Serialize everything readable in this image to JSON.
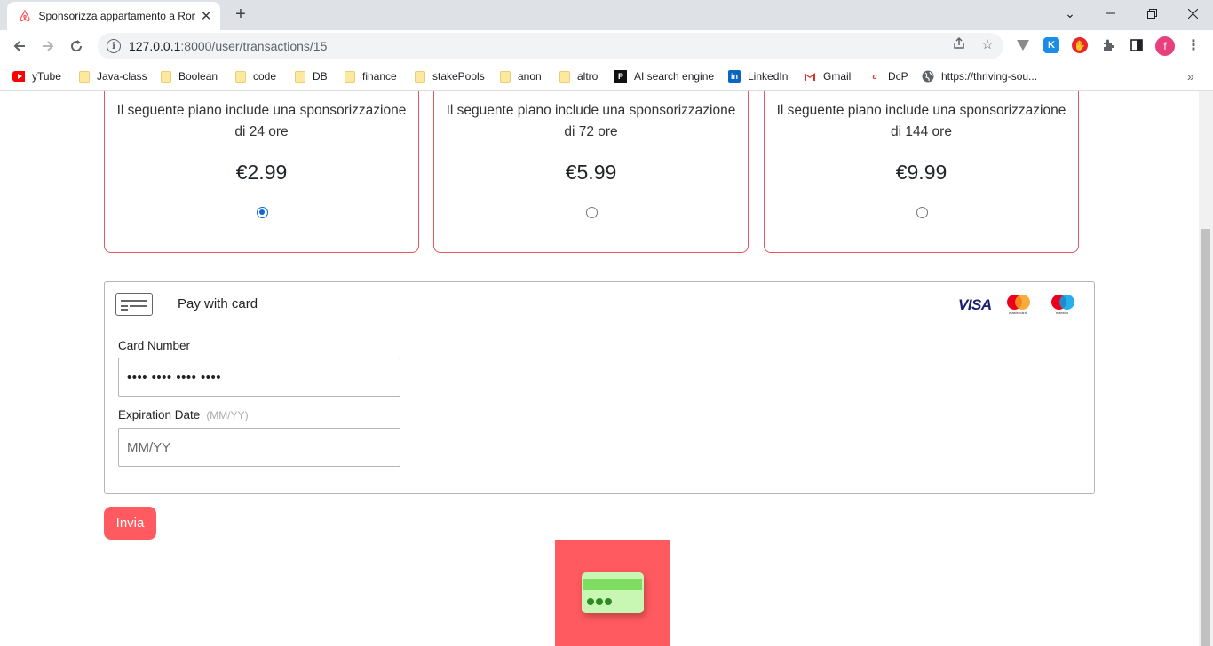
{
  "browser": {
    "tab_title": "Sponsorizza appartamento a Roma",
    "url_host": "127.0.0.1",
    "url_rest": ":8000/user/transactions/15",
    "profile_initial": "f",
    "bookmarks": [
      {
        "label": "yTube",
        "icon": "youtube-icon"
      },
      {
        "label": "Java-class",
        "icon": "folder-icon"
      },
      {
        "label": "Boolean",
        "icon": "folder-icon"
      },
      {
        "label": "code",
        "icon": "folder-icon"
      },
      {
        "label": "DB",
        "icon": "folder-icon"
      },
      {
        "label": "finance",
        "icon": "folder-icon"
      },
      {
        "label": "stakePools",
        "icon": "folder-icon"
      },
      {
        "label": "anon",
        "icon": "folder-icon"
      },
      {
        "label": "altro",
        "icon": "folder-icon"
      },
      {
        "label": "AI search engine",
        "icon": "perplexity-icon"
      },
      {
        "label": "LinkedIn",
        "icon": "linkedin-icon"
      },
      {
        "label": "Gmail",
        "icon": "gmail-icon"
      },
      {
        "label": "DcP",
        "icon": "dcp-icon"
      },
      {
        "label": "https://thriving-sou...",
        "icon": "globe-icon"
      }
    ]
  },
  "plans": [
    {
      "description": "Il seguente piano include una sponsorizzazione di 24 ore",
      "price": "€2.99",
      "selected": true
    },
    {
      "description": "Il seguente piano include una sponsorizzazione di 72 ore",
      "price": "€5.99",
      "selected": false
    },
    {
      "description": "Il seguente piano include una sponsorizzazione di 144 ore",
      "price": "€9.99",
      "selected": false
    }
  ],
  "payment": {
    "title": "Pay with card",
    "brand_visa": "VISA",
    "brand_mastercard": "mastercard",
    "brand_maestro": "maestro",
    "card_number_label": "Card Number",
    "card_number_value": "•••• •••• •••• ••••",
    "expiration_label": "Expiration Date",
    "expiration_hint": "(MM/YY)",
    "expiration_placeholder": "MM/YY"
  },
  "submit_label": "Invia",
  "colors": {
    "accent": "#ff5a5f",
    "plan_border": "#e0595f",
    "radio_checked": "#0b66d8"
  }
}
